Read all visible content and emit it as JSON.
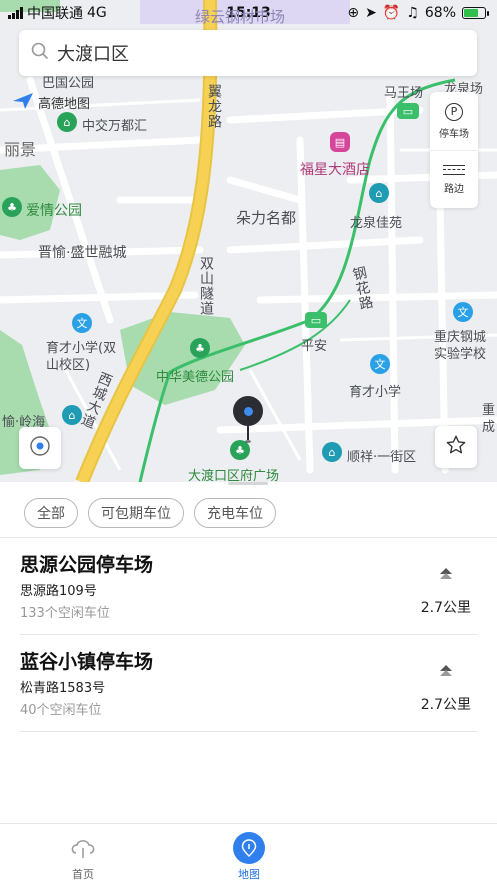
{
  "status_bar": {
    "carrier": "中国联通",
    "network": "4G",
    "time": "15:13",
    "battery": "68%"
  },
  "search": {
    "value": "大渡口区"
  },
  "map": {
    "logo_text": "高德地图",
    "labels": {
      "top_street": "绿云钢材市场",
      "park_top": "巴国公园",
      "poi_mall": "中交万都汇",
      "lijing": "丽景",
      "love_park": "爱情公园",
      "jinyu": "晋愉·盛世融城",
      "yilong_road": "翼龙路",
      "mazhuang": "马王场",
      "longmaochang": "龙泉场",
      "fuxing_hotel": "福星大酒店",
      "duoli": "朵力名都",
      "longquan_garden": "龙泉佳苑",
      "shuangshan_tunnel": "双山隧道",
      "ganghua_road": "钢花路",
      "chongqing_steel": "重庆钢城实验学校",
      "yucai_shuangshan": "育才小学(双山校区)",
      "pingan": "平安",
      "zhonghua_park": "中华美德公园",
      "yucai": "育才小学",
      "xicheng_road": "西城大道",
      "yu_lingbai": "愉·岭海",
      "shunxiang": "顺祥·一街区",
      "zhongcheng": "重成",
      "square": "大渡口区府广场"
    },
    "tools": {
      "parking": "停车场",
      "roadside": "路边"
    }
  },
  "filters": [
    "全部",
    "可包期车位",
    "充电车位"
  ],
  "parking_lots": [
    {
      "name": "思源公园停车场",
      "address": "思源路109号",
      "free_spaces": "133个空闲车位",
      "distance": "2.7公里"
    },
    {
      "name": "蓝谷小镇停车场",
      "address": "松青路1583号",
      "free_spaces": "40个空闲车位",
      "distance": "2.7公里"
    }
  ],
  "tabbar": {
    "home": "首页",
    "map": "地图"
  },
  "colors": {
    "accent": "#2f80ed",
    "road_yellow": "#f7d154",
    "park_green": "#a8dcae"
  }
}
